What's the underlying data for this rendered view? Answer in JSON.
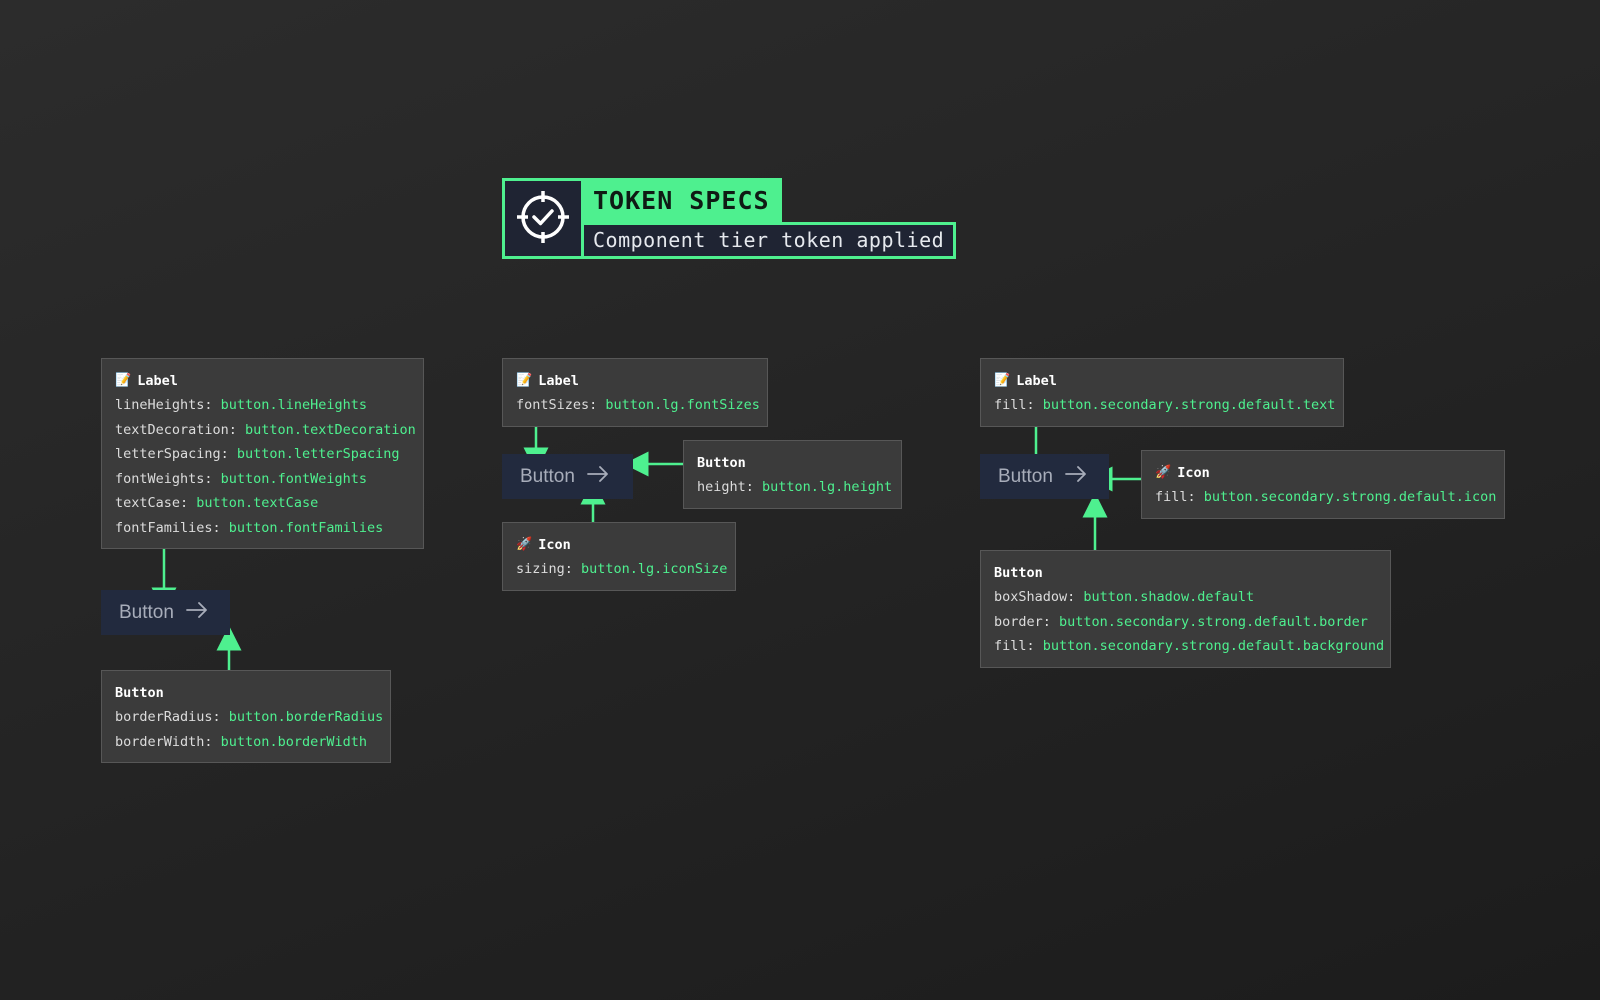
{
  "header": {
    "title": "TOKEN SPECS",
    "subtitle": "Component tier token applied",
    "icon": "target-check-icon",
    "accent_color": "#4ef08f"
  },
  "columns": [
    {
      "label_spec": {
        "icon": "memo-icon",
        "title": "Label",
        "rows": [
          {
            "key": "lineHeights: ",
            "value": "button.lineHeights"
          },
          {
            "key": "textDecoration: ",
            "value": "button.textDecoration"
          },
          {
            "key": "letterSpacing: ",
            "value": "button.letterSpacing"
          },
          {
            "key": "fontWeights: ",
            "value": "button.fontWeights"
          },
          {
            "key": "textCase: ",
            "value": "button.textCase"
          },
          {
            "key": "fontFamilies: ",
            "value": "button.fontFamilies"
          }
        ]
      },
      "button_label": "Button",
      "button_spec": {
        "title": "Button",
        "rows": [
          {
            "key": "borderRadius: ",
            "value": "button.borderRadius"
          },
          {
            "key": "borderWidth: ",
            "value": "button.borderWidth"
          }
        ]
      }
    },
    {
      "label_spec": {
        "icon": "memo-icon",
        "title": "Label",
        "rows": [
          {
            "key": "fontSizes: ",
            "value": "button.lg.fontSizes"
          }
        ]
      },
      "button_label": "Button",
      "button_spec": {
        "title": "Button",
        "rows": [
          {
            "key": "height: ",
            "value": "button.lg.height"
          }
        ]
      },
      "icon_spec": {
        "icon": "rocket-icon",
        "title": "Icon",
        "rows": [
          {
            "key": "sizing: ",
            "value": "button.lg.iconSize"
          }
        ]
      }
    },
    {
      "label_spec": {
        "icon": "memo-icon",
        "title": "Label",
        "rows": [
          {
            "key": "fill: ",
            "value": "button.secondary.strong.default.text"
          }
        ]
      },
      "button_label": "Button",
      "icon_spec": {
        "icon": "rocket-icon",
        "title": "Icon",
        "rows": [
          {
            "key": "fill: ",
            "value": "button.secondary.strong.default.icon"
          }
        ]
      },
      "button_spec": {
        "title": "Button",
        "rows": [
          {
            "key": "boxShadow: ",
            "value": "button.shadow.default"
          },
          {
            "key": "border: ",
            "value": "button.secondary.strong.default.border"
          },
          {
            "key": "fill: ",
            "value": "button.secondary.strong.default.background"
          }
        ]
      }
    }
  ]
}
